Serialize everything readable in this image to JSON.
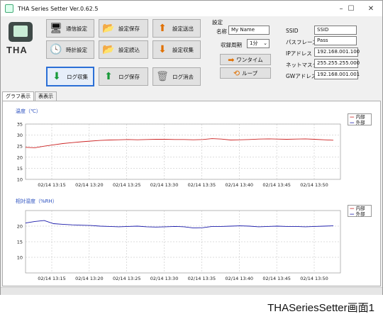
{
  "window": {
    "title": "THA Series Setter Ver.0.62.5",
    "minimize": "–",
    "maximize": "☐",
    "close": "✕"
  },
  "logo": {
    "text": "THA"
  },
  "buttons": {
    "comm_settings": "通信設定",
    "save_settings": "設定保存",
    "send_settings": "設定送出",
    "clock_settings": "時計設定",
    "load_settings": "設定読込",
    "collect_settings": "設定収集",
    "collect_log": "ログ収集",
    "save_log": "ログ保存",
    "clear_log": "ログ消去"
  },
  "settings": {
    "group_label": "設定",
    "name_label": "名称",
    "name_value": "My Name",
    "interval_label": "収録周期",
    "interval_value": "1分",
    "oneshot_label": "ワンタイム",
    "loop_label": "ループ"
  },
  "network": {
    "ssid_label": "SSID",
    "ssid_value": "SSID",
    "pass_label": "パスフレーズ",
    "pass_value": "Pass",
    "ip_label": "IPアドレス",
    "ip_value": "192.168.001.100",
    "mask_label": "ネットマスク",
    "mask_value": "255.255.255.000",
    "gw_label": "GWアドレス",
    "gw_value": "192.168.001.001"
  },
  "tabs": [
    {
      "label": "グラフ表示"
    },
    {
      "label": "表表示"
    }
  ],
  "caption": "THASeriesSetter画面1",
  "colors": {
    "inner": "#cc2222",
    "outer": "#1a1aaa",
    "title": "#2a4fbf"
  },
  "chart_data": [
    {
      "type": "line",
      "title": "温度（℃）",
      "ylim": [
        10,
        35
      ],
      "yticks": [
        10,
        15,
        20,
        25,
        30,
        35
      ],
      "x": [
        "02/14 13:15",
        "02/14 13:20",
        "02/14 13:25",
        "02/14 13:30",
        "02/14 13:35",
        "02/14 13:40",
        "02/14 13:45",
        "02/14 13:50"
      ],
      "legend": [
        "内部",
        "外部"
      ],
      "series": [
        {
          "name": "内部",
          "color": "#cc2222",
          "values": [
            24.5,
            24.3,
            25.0,
            25.6,
            26.2,
            26.6,
            27.0,
            27.3,
            27.6,
            27.8,
            27.9,
            28.0,
            27.9,
            28.0,
            28.1,
            28.1,
            28.0,
            28.0,
            27.9,
            28.0,
            28.4,
            28.2,
            27.8,
            27.9,
            28.0,
            28.2,
            28.3,
            28.2,
            28.1,
            28.2,
            28.3,
            28.1,
            27.9,
            27.7
          ]
        }
      ]
    },
    {
      "type": "line",
      "title": "相対湿度（%RH）",
      "ylim": [
        5,
        25
      ],
      "yticks": [
        10,
        15,
        20
      ],
      "x": [
        "02/14 13:15",
        "02/14 13:20",
        "02/14 13:25",
        "02/14 13:30",
        "02/14 13:35",
        "02/14 13:40",
        "02/14 13:45",
        "02/14 13:50"
      ],
      "legend": [
        "内部",
        "外部"
      ],
      "series": [
        {
          "name": "外部",
          "color": "#1a1aaa",
          "values": [
            21.0,
            21.5,
            21.8,
            20.8,
            20.6,
            20.4,
            20.3,
            20.2,
            20.0,
            19.9,
            19.8,
            19.9,
            20.0,
            19.8,
            19.7,
            19.8,
            19.9,
            19.8,
            19.4,
            19.5,
            19.9,
            19.9,
            20.0,
            20.1,
            20.0,
            19.8,
            19.9,
            20.0,
            19.9,
            19.9,
            19.8,
            19.9,
            20.0,
            20.1
          ]
        }
      ]
    }
  ]
}
